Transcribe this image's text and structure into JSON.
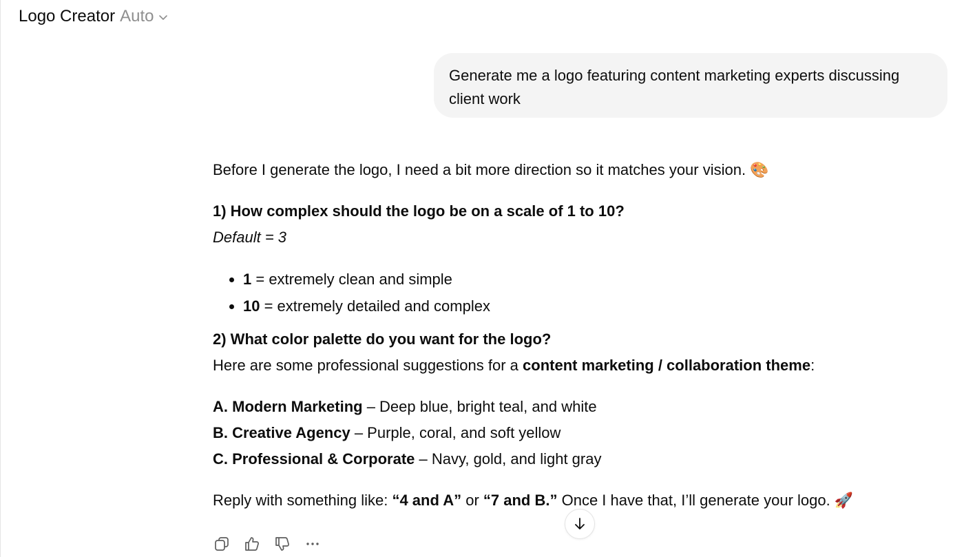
{
  "header": {
    "title": "Logo Creator",
    "model": "Auto",
    "dropdown_icon": "chevron-down-icon"
  },
  "user_message": {
    "text": "Generate me a logo featuring content marketing experts discussing client work"
  },
  "assistant_message": {
    "intro": "Before I generate the logo, I need a bit more direction so it matches your vision. 🎨",
    "q1": {
      "heading": "1) How complex should the logo be on a scale of 1 to 10?",
      "default": "Default = 3",
      "items": [
        {
          "value": "1",
          "text": " = extremely clean and simple"
        },
        {
          "value": "10",
          "text": " = extremely detailed and complex"
        }
      ]
    },
    "q2": {
      "heading": "2) What color palette do you want for the logo?",
      "lead": "Here are some professional suggestions for a ",
      "lead_bold": "content marketing / collaboration theme",
      "lead_end": ":",
      "options": [
        {
          "name": "A. Modern Marketing",
          "desc": " – Deep blue, bright teal, and white"
        },
        {
          "name": "B. Creative Agency",
          "desc": " – Purple, coral, and soft yellow"
        },
        {
          "name": "C. Professional & Corporate",
          "desc": " – Navy, gold, and light gray"
        }
      ]
    },
    "reply": {
      "pre": "Reply with something like: ",
      "ex1": "“4 and A”",
      "mid": " or ",
      "ex2": "“7 and B.”",
      "post": " Once I have that, I’ll generate your logo. 🚀"
    }
  },
  "actions": {
    "icons": [
      "copy-icon",
      "thumbs-up-icon",
      "thumbs-down-icon",
      "more-icon"
    ]
  },
  "scroll_button": {
    "icon": "arrow-down-icon"
  },
  "colors": {
    "text": "#0d0d0d",
    "muted": "#8f8f8f",
    "bubble": "#f4f4f4",
    "icon": "#5d5d5d"
  }
}
